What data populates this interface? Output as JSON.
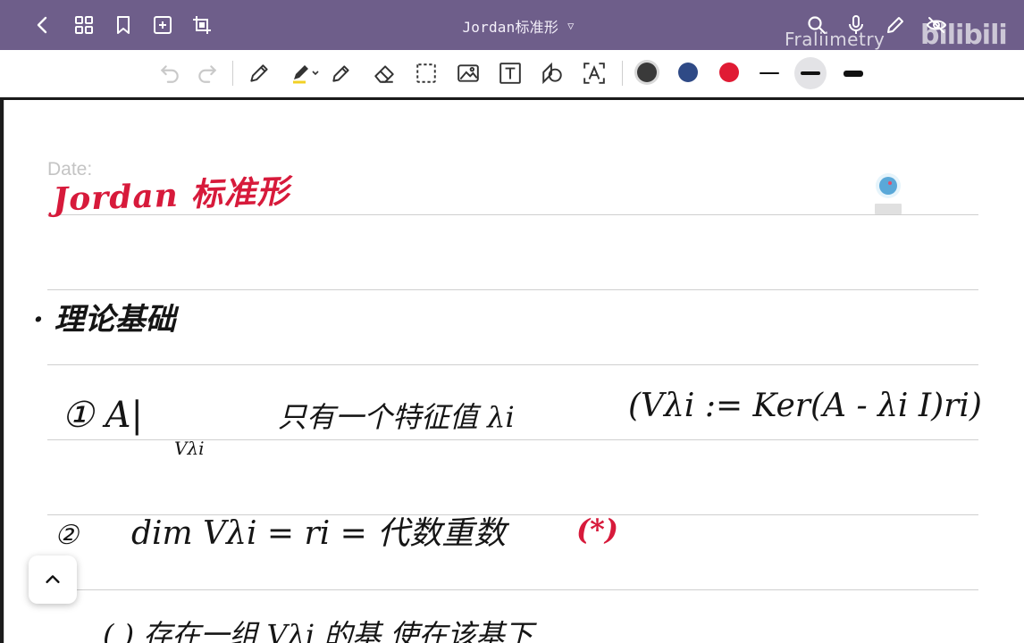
{
  "header": {
    "title": "Jordan标准形",
    "watermark": "Fraliimetry",
    "logo_text": "bilibili",
    "nav_icons": [
      "back-icon",
      "grid-icon",
      "bookmark-icon",
      "add-page-icon",
      "crop-icon"
    ],
    "right_icons": [
      "search-icon",
      "microphone-icon",
      "pen-mode-icon",
      "eye-off-icon"
    ]
  },
  "toolbar": {
    "tools": [
      "undo-icon",
      "redo-icon",
      "pen-icon",
      "highlighter-icon",
      "pencil-icon",
      "eraser-icon",
      "lasso-select-icon",
      "image-icon",
      "text-icon",
      "shape-icon",
      "ocr-text-icon"
    ],
    "colors": [
      "#3a3a3a",
      "#2f4a86",
      "#e01b34"
    ],
    "selected_color": "#3a3a3a",
    "stroke_widths": [
      "thin",
      "medium",
      "thick"
    ],
    "selected_stroke": "medium"
  },
  "note": {
    "date_label": "Date:",
    "title": "Jordan 标准形",
    "lines": [
      {
        "id": "basics",
        "text": "· 理论基础"
      },
      {
        "id": "item1_label",
        "text": "① A|"
      },
      {
        "id": "item1_sub",
        "text": "Vλi"
      },
      {
        "id": "item1_desc",
        "text": "只有一个特征值 λi"
      },
      {
        "id": "item1_def",
        "text": "(Vλi := Ker(A - λi I)ri)"
      },
      {
        "id": "item2_label",
        "text": "②"
      },
      {
        "id": "item2_text",
        "text": "dim Vλi = ri = 代数重数"
      },
      {
        "id": "item2_mark",
        "text": "(*)"
      },
      {
        "id": "item3_partial",
        "text": "(  )  存在一组 Vλi 的基 使在该基下"
      }
    ]
  }
}
